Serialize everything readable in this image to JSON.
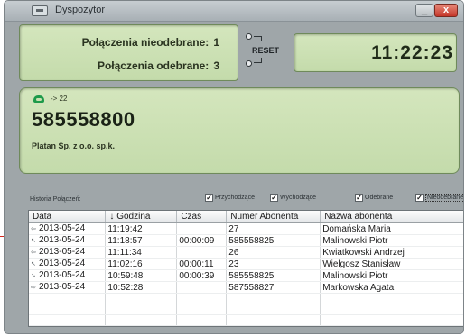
{
  "window": {
    "title": "Dyspozytor",
    "minimize_label": "_",
    "close_label": "x"
  },
  "counters": {
    "missed_label": "Połączenia nieodebrane:",
    "missed_value": "1",
    "answered_label": "Połączenia odebrane:",
    "answered_value": "3"
  },
  "reset": {
    "label": "RESET"
  },
  "clock": {
    "time": "11:22:23"
  },
  "call": {
    "direction_text": "-> 22",
    "number": "585558800",
    "company": "Platan Sp. z o.o. sp.k.",
    "phone_icon": "phone-icon"
  },
  "filters": {
    "history_label": "Historia Połączeń:",
    "incoming": {
      "label": "Przychodzące",
      "checked": true
    },
    "outgoing": {
      "label": "Wychodzące",
      "checked": true
    },
    "answered": {
      "label": "Odebrane",
      "checked": true
    },
    "missed": {
      "label": "Nieodebrane",
      "checked": true
    }
  },
  "table": {
    "columns": [
      "Data",
      "↓ Godzina",
      "Czas",
      "Numer Abonenta",
      "Nazwa abonenta"
    ],
    "rows": [
      {
        "icon": "incoming-missed-icon",
        "date": "2013-05-24",
        "time": "11:19:42",
        "duration": "",
        "number": "27",
        "name": "Domańska Maria"
      },
      {
        "icon": "incoming-answered-icon",
        "date": "2013-05-24",
        "time": "11:18:57",
        "duration": "00:00:09",
        "number": "585558825",
        "name": "Malinowski Piotr"
      },
      {
        "icon": "incoming-missed-icon",
        "date": "2013-05-24",
        "time": "11:11:34",
        "duration": "",
        "number": "26",
        "name": "Kwiatkowski Andrzej"
      },
      {
        "icon": "incoming-answered-icon",
        "date": "2013-05-24",
        "time": "11:02:16",
        "duration": "00:00:11",
        "number": "23",
        "name": "Wielgosz Stanisław"
      },
      {
        "icon": "outgoing-answered-icon",
        "date": "2013-05-24",
        "time": "10:59:48",
        "duration": "00:00:39",
        "number": "585558825",
        "name": "Malinowski Piotr"
      },
      {
        "icon": "outgoing-missed-icon",
        "date": "2013-05-24",
        "time": "10:52:28",
        "duration": "",
        "number": "587558827",
        "name": "Markowska Agata"
      },
      {
        "icon": "",
        "date": "",
        "time": "",
        "duration": "",
        "number": "",
        "name": ""
      },
      {
        "icon": "",
        "date": "",
        "time": "",
        "duration": "",
        "number": "",
        "name": ""
      },
      {
        "icon": "",
        "date": "",
        "time": "",
        "duration": "",
        "number": "",
        "name": ""
      }
    ]
  }
}
